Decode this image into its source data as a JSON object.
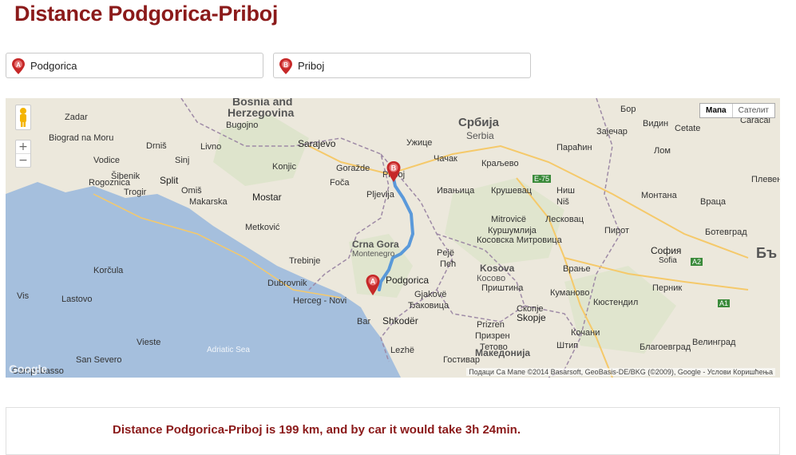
{
  "page": {
    "title": "Distance Podgorica-Priboj"
  },
  "route": {
    "from": {
      "marker": "A",
      "value": "Podgorica"
    },
    "to": {
      "marker": "B",
      "value": "Priboj"
    }
  },
  "map": {
    "map_type_options": [
      "Мапа",
      "Сателит"
    ],
    "active_map_type": "Мапа",
    "zoom_in": "+",
    "zoom_out": "−",
    "attribution": "Подаци Са Мапе ©2014 Basarsoft, GeoBasis-DE/BKG (©2009), Google - Услови Коришћења",
    "logo": "Google",
    "labels": {
      "bosnia": "Bosnia and",
      "herzegovina": "Herzegovina",
      "srbija": "Србија",
      "serbia": "Serbia",
      "crna_gora": "Crna Gora",
      "montenegro": "Montenegro",
      "kosova": "Kosova",
      "kosovo": "Косово",
      "sarajevo": "Sarajevo",
      "mostar": "Mostar",
      "split": "Split",
      "podgorica": "Podgorica",
      "priboj": "Priboj",
      "pljevlja": "Pljevlja",
      "bugojno": "Bugojno",
      "livno": "Livno",
      "makarska": "Makarska",
      "sibenik": "Šibenik",
      "drnis": "Drniš",
      "trebinje": "Trebinje",
      "dubrovnik": "Dubrovnik",
      "herceg_novi": "Herceg - Novi",
      "shkoder": "Shkodër",
      "bar": "Bar",
      "pec": "Пећ",
      "peje": "Pejë",
      "gjakove": "Gjakovë",
      "djakovica": "Ђаковица",
      "prizren": "Prizren",
      "prizren_cyr": "Призрен",
      "skopje": "Skopje",
      "skopje_cyr": "Скопје",
      "pristina": "Приштина",
      "nis": "Ниш",
      "nis_lat": "Niš",
      "krusevac": "Крушевац",
      "kraljevo": "Краљево",
      "cacak": "Чачак",
      "uzice": "Ужице",
      "sofia": "София",
      "sofia_lat": "Sofia",
      "adriatic": "Adriatic Sea",
      "vieste": "Vieste",
      "san_severo": "San Severo",
      "campobasso": "Campobasso",
      "vidin": "Видин",
      "pleven": "Плевен",
      "pernik": "Перник",
      "kjustendil": "Кюстендил",
      "blagoevgrad": "Благоевград",
      "velingrad": "Велинград",
      "vraca": "Враца",
      "montana": "Монтана",
      "vranje": "Врање",
      "leskovac": "Лесковац",
      "pirot": "Пирот",
      "zajecar": "Зајечар",
      "parachin": "Параћин",
      "mitrovice": "Mitrovicë",
      "kosovska_mitrovica": "Косовска Митровица",
      "kumanovo": "Куманово",
      "tetovo": "Тетово",
      "makedonija": "Македонија",
      "kochani": "Кочани",
      "shtip": "Штип",
      "gostivar": "Гостивар",
      "lezhe": "Lezhë",
      "konjic": "Konjic",
      "gorazde": "Goražde",
      "foca": "Foča",
      "metkovic": "Metković",
      "ivanjica": "Ивањица",
      "kursumlija": "Куршумлија",
      "bor": "Бор",
      "lom": "Лом",
      "cetate": "Cetate",
      "caracal": "Caracal",
      "botevgrad": "Ботевград",
      "bulgaria_partial": "Бъ",
      "omis": "Omiš",
      "trogir": "Trogir",
      "rogoznica": "Rogoznica",
      "vodice": "Vodice",
      "biograd": "Biograd na Moru",
      "zadar": "Zadar",
      "sinj": "Sinj",
      "vis": "Vis",
      "korcula": "Korčula",
      "lastovo": "Lastovo",
      "e75": "E-75",
      "a2": "A2",
      "a1": "A1"
    }
  },
  "result": {
    "text": "Distance Podgorica-Priboj is 199 km, and by car it would take 3h 24min."
  },
  "colors": {
    "title": "#8b1a1a",
    "sea": "#a5bfdd",
    "land": "#ece8dc",
    "route": "#4a90d9",
    "marker": "#c62828"
  }
}
